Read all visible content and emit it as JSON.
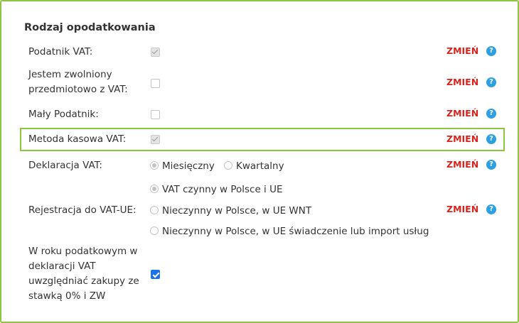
{
  "section_title": "Rodzaj opodatkowania",
  "change_label": "ZMIEŃ",
  "help_glyph": "?",
  "rows": {
    "vat_payer": {
      "label": "Podatnik VAT:",
      "checked": true
    },
    "exempt": {
      "label_line1": "Jestem zwolniony",
      "label_line2": "przedmiotowo z VAT:",
      "checked": false
    },
    "small_taxpayer": {
      "label": "Mały Podatnik:",
      "checked": false
    },
    "cash_method": {
      "label": "Metoda kasowa VAT:",
      "checked": true
    },
    "declaration": {
      "label": "Deklaracja VAT:",
      "options": [
        "Miesięczny",
        "Kwartalny"
      ],
      "selected": "Miesięczny"
    },
    "vat_ue": {
      "label": "Rejestracja do VAT-UE:",
      "options": [
        "VAT czynny w Polsce i UE",
        "Nieczynny w Polsce, w UE WNT",
        "Nieczynny w Polsce, w UE świadczenie lub import usług"
      ],
      "selected": "VAT czynny w Polsce i UE"
    },
    "zero_rate": {
      "label_lines": [
        "W roku podatkowym w",
        "deklaracji VAT",
        "uwzględniać zakupy ze",
        "stawką 0% i ZW"
      ],
      "checked": true
    }
  },
  "colors": {
    "accent_green": "#8dc63f",
    "change_red": "#d9231d",
    "help_blue": "#2d9fe3",
    "checkbox_blue": "#1a73e8"
  },
  "icons": {
    "help": "question-circle-icon"
  }
}
